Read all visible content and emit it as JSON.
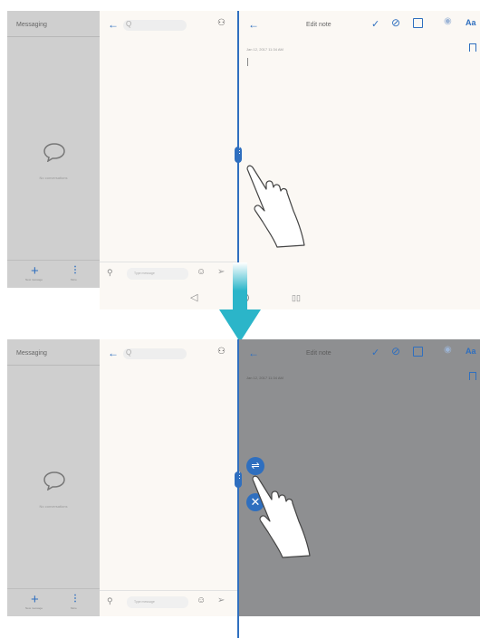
{
  "messaging": {
    "title": "Messaging",
    "empty_text": "No conversations",
    "new_label": "New message",
    "more_label": "More"
  },
  "thread": {
    "search_placeholder": "Q",
    "message_placeholder": "Type message"
  },
  "note": {
    "title": "Edit note",
    "date": "Jan 12, 2017 11:34 AM",
    "aa_label": "Aa"
  },
  "icons": {
    "back": "←",
    "check": "✓",
    "check_circle": "⊘",
    "camera": "◉",
    "contact": "⚇",
    "clip": "⚲",
    "emoji": "☺",
    "send": "➢",
    "plus": "+",
    "more": "⋮",
    "nav_back": "◁",
    "nav_recent": "▯▯",
    "swap": "⇌",
    "close": "✕",
    "handle_dots": "⋮"
  },
  "colors": {
    "accent": "#2f6fbf",
    "dim_overlay": "#8e8f91",
    "arrow": "#2bb5c9"
  }
}
